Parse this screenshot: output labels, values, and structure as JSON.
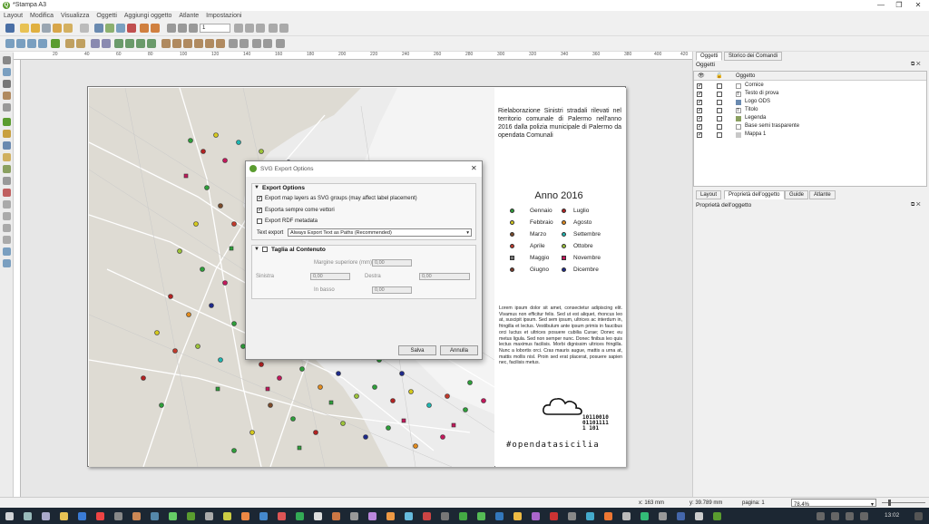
{
  "app": {
    "title": "*Stampa A3"
  },
  "window_controls": {
    "minimize": "—",
    "restore": "❐",
    "close": "✕"
  },
  "menu": [
    "Layout",
    "Modifica",
    "Visualizza",
    "Oggetti",
    "Aggiungi oggetto",
    "Atlante",
    "Impostazioni"
  ],
  "toolbar": {
    "page_field": "1"
  },
  "ruler": {
    "ticks": [
      "20",
      "40",
      "60",
      "80",
      "100",
      "120",
      "140",
      "160",
      "180",
      "200",
      "220",
      "240",
      "260",
      "280",
      "300",
      "320",
      "340",
      "360",
      "380",
      "400",
      "420"
    ]
  },
  "layout_page": {
    "description": "Rielaborazione Sinistri stradali rilevati nel territorio comunale di Palermo nell'anno 2016 dalla polizia municipale di Palermo da opendata Comunali",
    "year_title": "Anno 2016",
    "legend_left": [
      "Gennaio",
      "Febbraio",
      "Marzo",
      "Aprile",
      "Maggio",
      "Giugno"
    ],
    "legend_right": [
      "Luglio",
      "Agosto",
      "Settembre",
      "Ottobre",
      "Novembre",
      "Dicembre"
    ],
    "legend_colors_left": [
      "#2e9e3a",
      "#d4c81e",
      "#7a4a2a",
      "#c0392b",
      "#777777",
      "#7a3a2a"
    ],
    "legend_colors_right": [
      "#b22222",
      "#e08a1e",
      "#1fb5b0",
      "#9cc23a",
      "#c2185b",
      "#1e2a8a"
    ],
    "lorem": "Lorem ipsum dolor sit amet, consectetur adipiscing elit. Vivamus non efficitur felis. Sed ut est aliquet, rhoncus leo at, suscipit ipsum. Sed sem ipsum, ultrices ac interdum in, fringilla et lectus. Vestibulum ante ipsum primis in faucibus orci luctus et ultrices posuere cubilia Curae; Donec eu metus ligula. Sed non semper nunc. Donec finibus leo quis lectus maximus facilisis. Morbi dignissim ultrices fringilla. Nunc a lobortis orci. Cras mauris augue, mattis a urna at, mattis mollis nisl. Proin sed erat placerat, posuere sapien nec, facilisis metus.",
    "logo_bits": [
      "10110010",
      "01101111",
      "1  101"
    ],
    "brand": "#opendatasicilia"
  },
  "dialog": {
    "title": "SVG Export Options",
    "export_group_title": "Export Options",
    "opt_svg_groups": "Export map layers as SVG groups (may affect label placement)",
    "opt_vectors": "Esporta sempre come vettori",
    "opt_rdf": "Export RDF metadata",
    "text_export_label": "Text export",
    "text_export_value": "Always Export Text as Paths (Recommended)",
    "crop_group_title": "Taglia al Contenuto",
    "margin_top_label": "Margine superiore (mm)",
    "margin_top_value": "0,00",
    "left_label": "Sinistra",
    "left_value": "0,00",
    "right_label": "Destra",
    "right_value": "0,00",
    "bottom_label": "In basso",
    "bottom_value": "0,00",
    "save_button": "Salva",
    "cancel_button": "Annulla"
  },
  "right_panel": {
    "top_tabs": [
      "Oggetti",
      "Storico dei Comandi"
    ],
    "objects_header": "Oggetti",
    "column_object": "Oggetto",
    "objects": [
      "Cornice",
      "Testo di prova",
      "Logo ODS",
      "Titolo",
      "Legenda",
      "Base semi trasparente",
      "Mappa 1"
    ],
    "bottom_tabs": [
      "Layout",
      "Proprietà dell'oggetto",
      "Guide",
      "Atlante"
    ],
    "properties_header": "Proprietà dell'oggetto"
  },
  "status": {
    "x": "x: 163 mm",
    "y": "y: 39.789 mm",
    "page": "pagina: 1",
    "zoom": "78.4%"
  },
  "taskbar": {
    "time": "13:02"
  }
}
